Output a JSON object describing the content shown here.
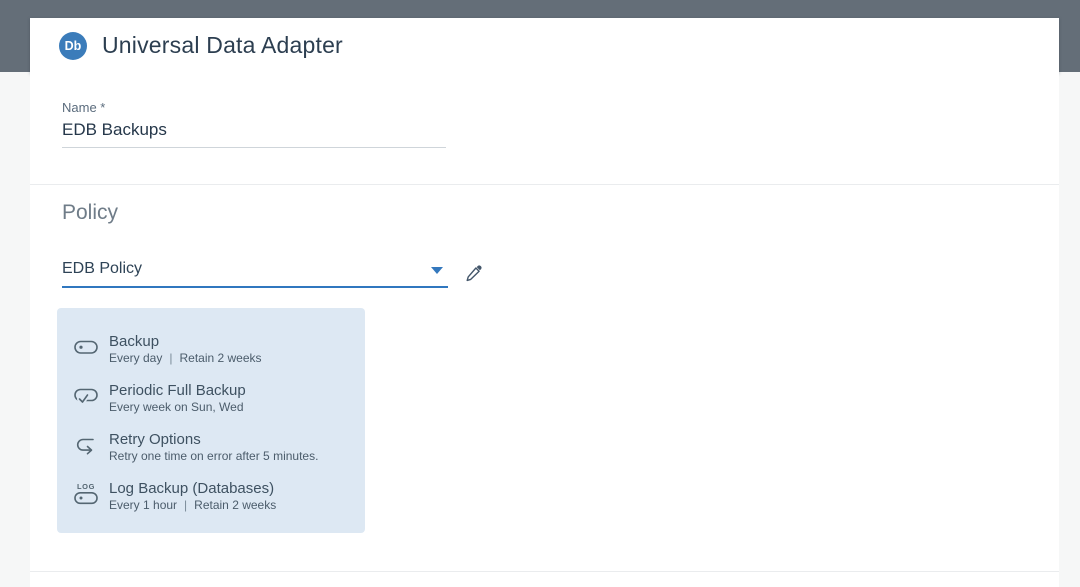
{
  "header": {
    "app_icon_label": "Db",
    "title": "Universal Data Adapter"
  },
  "form": {
    "name_field": {
      "label": "Name *",
      "value": "EDB Backups"
    }
  },
  "policy_section": {
    "heading": "Policy",
    "policy_select": {
      "value": "EDB Policy"
    },
    "edit_icon": "pencil-icon",
    "items": [
      {
        "icon": "backup-run-icon",
        "title": "Backup",
        "line_left": "Every day",
        "separator": "|",
        "line_right": "Retain 2 weeks"
      },
      {
        "icon": "periodic-full-backup-icon",
        "title": "Periodic Full Backup",
        "line_left": "Every week on Sun, Wed"
      },
      {
        "icon": "retry-options-icon",
        "title": "Retry Options",
        "line_left": "Retry one time on error after 5 minutes."
      },
      {
        "icon": "log-backup-icon",
        "icon_text": "LOG",
        "title": "Log Backup (Databases)",
        "line_left": "Every 1 hour",
        "separator": "|",
        "line_right": "Retain 2 weeks"
      }
    ]
  },
  "colors": {
    "top_band": "#646e78",
    "accent_blue": "#3077bf",
    "app_icon_bg": "#3b7cba",
    "policy_card_bg": "#dde8f3",
    "page_bg": "#f6f7f7"
  }
}
